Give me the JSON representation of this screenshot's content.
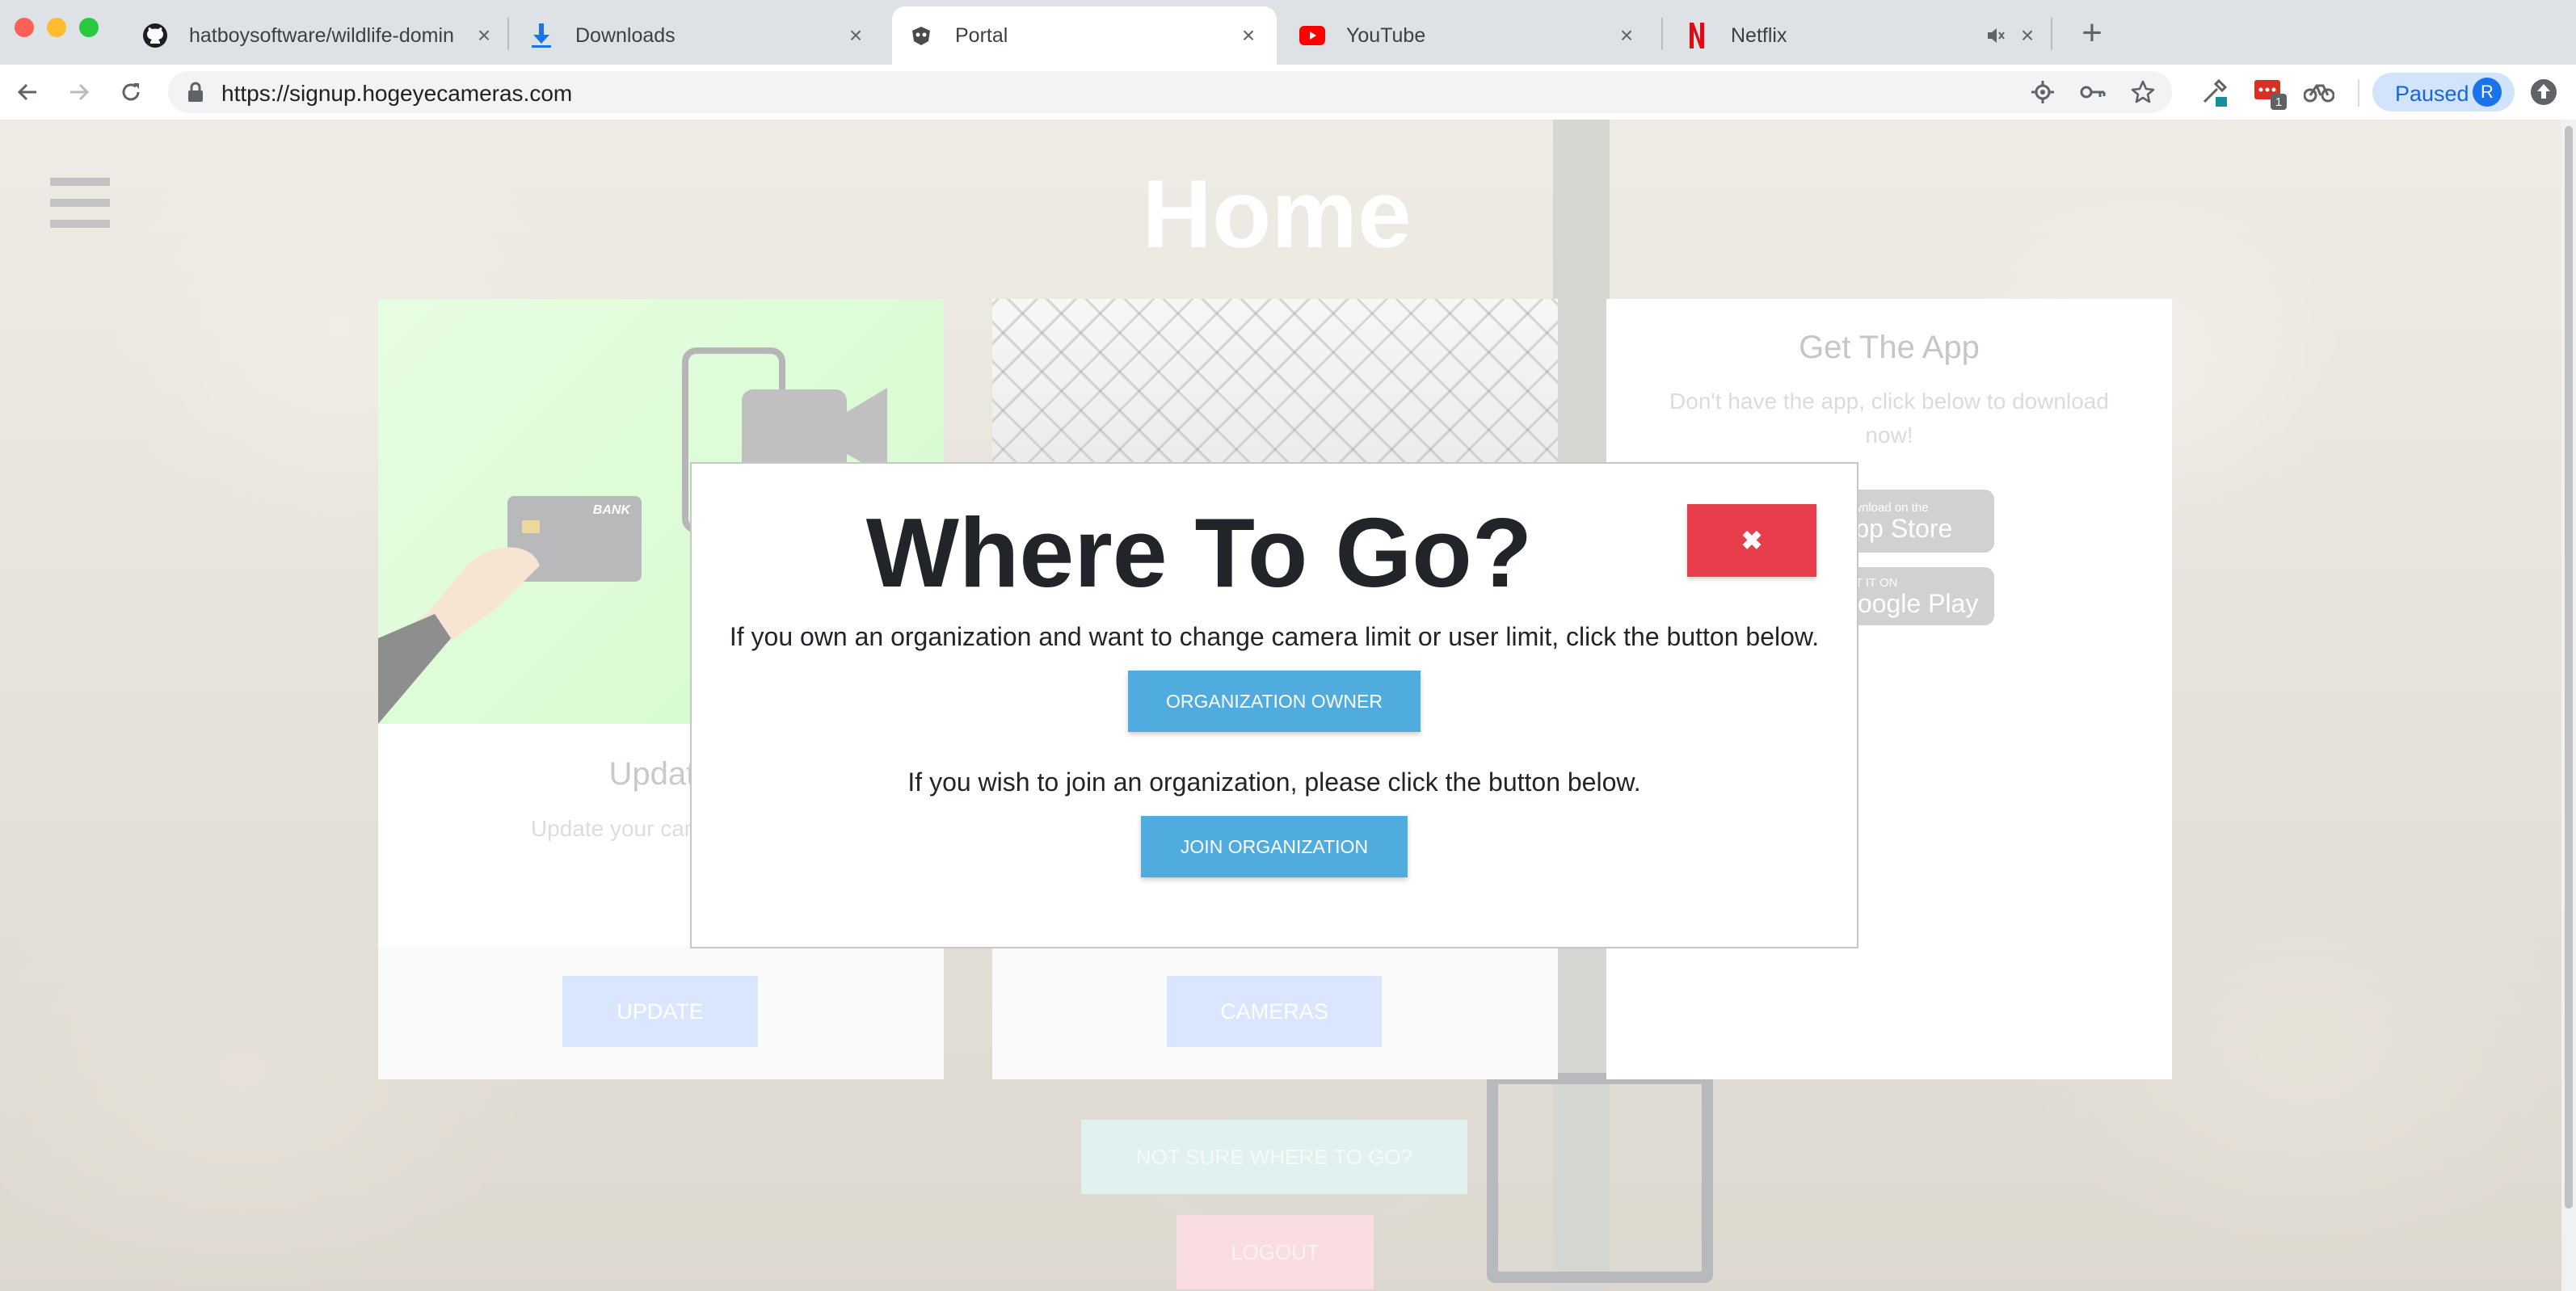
{
  "tabs": [
    {
      "title": "hatboysoftware/wildlife-domin",
      "icon": "github-icon"
    },
    {
      "title": "Downloads",
      "icon": "download-icon"
    },
    {
      "title": "Portal",
      "icon": "portal-icon"
    },
    {
      "title": "YouTube",
      "icon": "youtube-icon"
    },
    {
      "title": "Netflix",
      "icon": "netflix-icon"
    }
  ],
  "toolbar": {
    "url_host": "https://signup.hogeyecameras.com",
    "profile_status": "Paused",
    "profile_initial": "R",
    "extension_badge": "1"
  },
  "page": {
    "title": "Home",
    "cards": [
      {
        "title": "Update",
        "text": "Update your cameras and",
        "button": "UPDATE",
        "image_badge": "BANK"
      },
      {
        "button": "CAMERAS"
      },
      {
        "title": "Get The App",
        "text": "Don't have the app, click below to download now!",
        "app_store_small": "Download on the",
        "app_store_big": "App Store",
        "google_small": "GET IT ON",
        "google_big": "Google Play"
      }
    ],
    "not_sure_button": "NOT SURE WHERE TO GO?",
    "logout_button": "LOGOUT"
  },
  "modal": {
    "title": "Where To Go?",
    "close_symbol": "✖",
    "owner_text": "If you own an organization and want to change camera limit or user limit, click the button below.",
    "owner_button": "ORGANIZATION OWNER",
    "join_text": "If you wish to join an organization, please click the button below.",
    "join_button": "JOIN ORGANIZATION"
  },
  "colors": {
    "close_red": "#e83d4a",
    "modal_button_blue": "#50acdf",
    "profile_blue": "#1a73e8"
  }
}
